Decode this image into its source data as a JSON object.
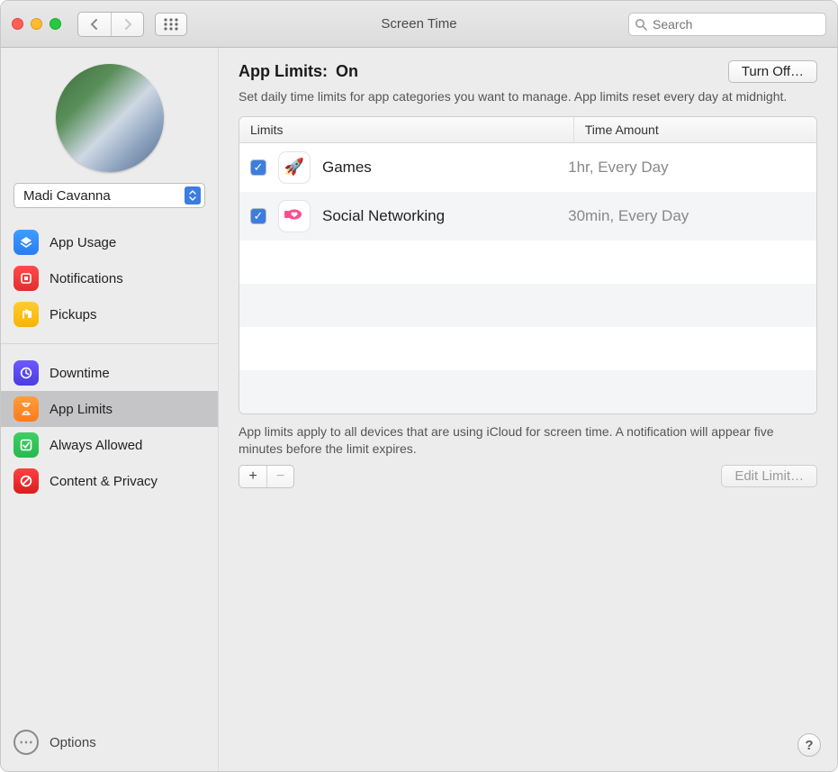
{
  "window": {
    "title": "Screen Time",
    "search_placeholder": "Search"
  },
  "sidebar": {
    "user_name": "Madi Cavanna",
    "group1": [
      {
        "label": "App Usage",
        "icon": "layers-icon"
      },
      {
        "label": "Notifications",
        "icon": "bell-icon"
      },
      {
        "label": "Pickups",
        "icon": "pickup-icon"
      }
    ],
    "group2": [
      {
        "label": "Downtime",
        "icon": "clock-icon"
      },
      {
        "label": "App Limits",
        "icon": "hourglass-icon",
        "selected": true
      },
      {
        "label": "Always Allowed",
        "icon": "check-icon"
      },
      {
        "label": "Content & Privacy",
        "icon": "block-icon"
      }
    ],
    "options_label": "Options"
  },
  "main": {
    "heading_prefix": "App Limits: ",
    "heading_state": "On",
    "turn_off_label": "Turn Off…",
    "description": "Set daily time limits for app categories you want to manage. App limits reset every day at midnight.",
    "columns": {
      "limits": "Limits",
      "amount": "Time Amount"
    },
    "rows": [
      {
        "enabled": true,
        "icon": "rocket-icon",
        "label": "Games",
        "amount": "1hr, Every Day"
      },
      {
        "enabled": true,
        "icon": "chat-heart-icon",
        "label": "Social Networking",
        "amount": "30min, Every Day"
      }
    ],
    "footer_note": "App limits apply to all devices that are using iCloud for screen time. A notification will appear five minutes before the limit expires.",
    "add_label": "+",
    "remove_label": "−",
    "edit_label": "Edit Limit…",
    "help_label": "?"
  }
}
